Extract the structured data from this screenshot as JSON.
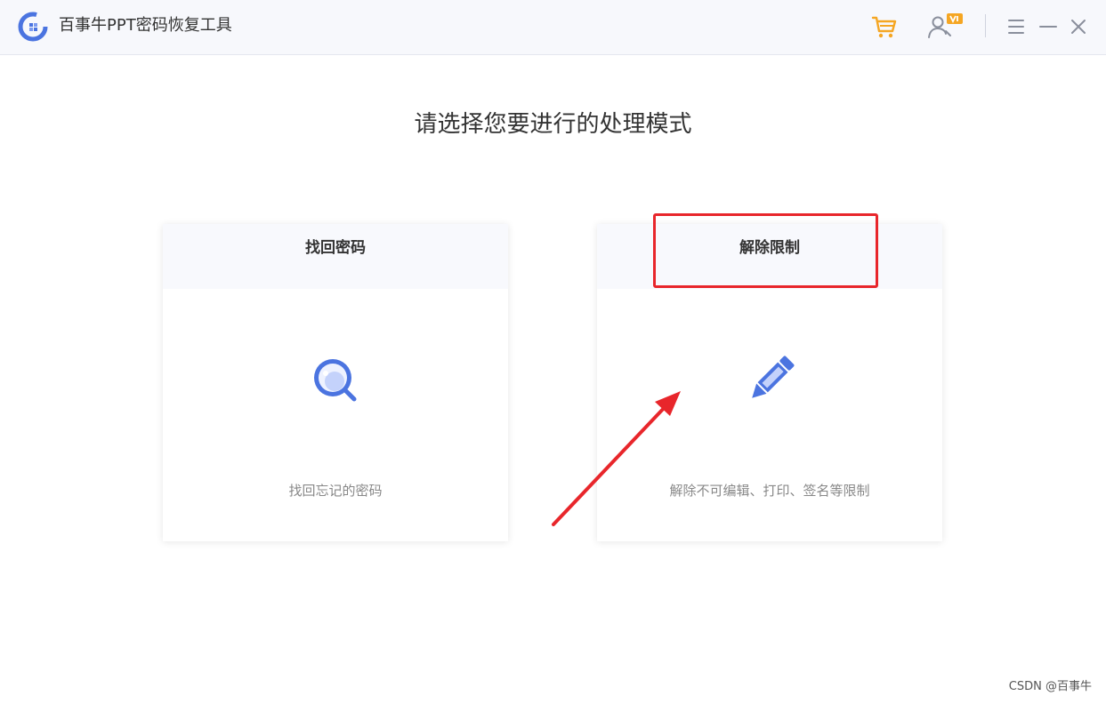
{
  "window": {
    "title": "百事牛PPT密码恢复工具"
  },
  "toolbar": {
    "icons": [
      "cart-icon",
      "user-vip-icon",
      "menu-icon",
      "minimize-icon",
      "close-icon"
    ],
    "accent_color": "#f5a623"
  },
  "main": {
    "heading": "请选择您要进行的处理模式",
    "cards": [
      {
        "title": "找回密码",
        "description": "找回忘记的密码",
        "icon": "magnifier-icon"
      },
      {
        "title": "解除限制",
        "description": "解除不可编辑、打印、签名等限制",
        "icon": "pencil-icon"
      }
    ],
    "icon_color": "#4b74e0"
  },
  "annotation": {
    "highlight_color": "#e8262b"
  },
  "watermark": "CSDN @百事牛"
}
